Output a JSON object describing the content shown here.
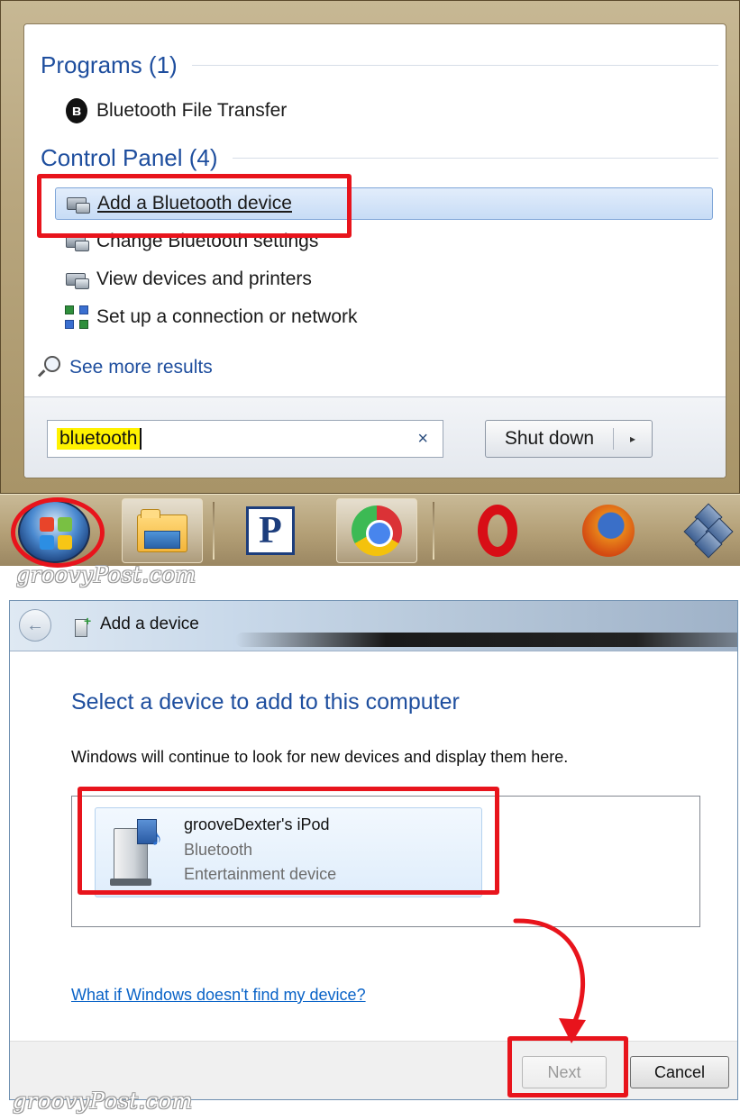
{
  "start_menu": {
    "programs_header": "Programs (1)",
    "programs": [
      {
        "label": "Bluetooth File Transfer",
        "icon": "bluetooth-icon"
      }
    ],
    "control_panel_header": "Control Panel (4)",
    "control_panel": [
      {
        "label": "Add a Bluetooth device",
        "icon": "devices-printers-icon",
        "highlighted": true
      },
      {
        "label": "Change Bluetooth settings",
        "icon": "devices-printers-icon"
      },
      {
        "label": "View devices and printers",
        "icon": "devices-printers-icon"
      },
      {
        "label": "Set up a connection or network",
        "icon": "network-icon"
      }
    ],
    "see_more": "See more results",
    "search_value": "bluetooth",
    "search_clear": "×",
    "shutdown_label": "Shut down",
    "shutdown_arrow": "▸"
  },
  "taskbar": {
    "items": [
      "windows-orb",
      "explorer-folder-icon",
      "p-app-icon",
      "chrome-icon",
      "opera-icon",
      "firefox-icon",
      "virtualbox-icon"
    ],
    "p_letter": "P"
  },
  "watermark": "groovyPost.com",
  "add_device_dialog": {
    "title": "Add a device",
    "back_glyph": "←",
    "heading": "Select a device to add to this computer",
    "subtext": "Windows will continue to look for new devices and display them here.",
    "device": {
      "name": "grooveDexter's iPod",
      "type": "Bluetooth",
      "category": "Entertainment device"
    },
    "help_link": "What if Windows doesn't find my device?",
    "next_label": "Next",
    "cancel_label": "Cancel",
    "next_enabled": false
  },
  "annotation_color": "#e8141c"
}
